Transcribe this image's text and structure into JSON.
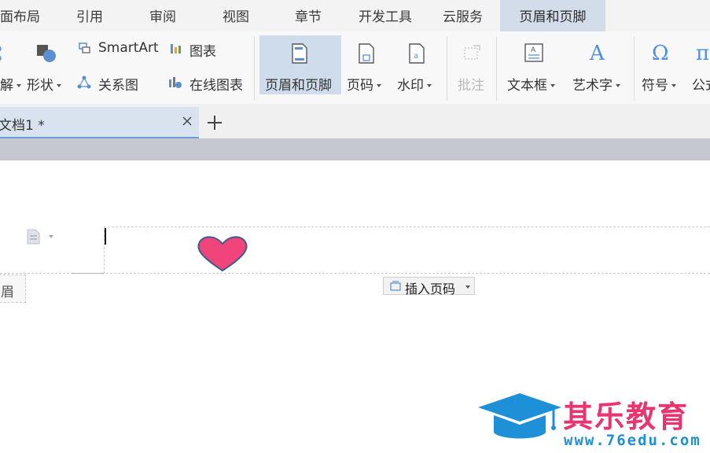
{
  "menu": {
    "tabs": [
      {
        "label": "面布局"
      },
      {
        "label": "引用"
      },
      {
        "label": "审阅"
      },
      {
        "label": "视图"
      },
      {
        "label": "章节"
      },
      {
        "label": "开发工具"
      },
      {
        "label": "云服务"
      },
      {
        "label": "页眉和页脚"
      }
    ],
    "active": "页眉和页脚"
  },
  "ribbon": {
    "partial_left": "解",
    "shapes": "形状",
    "smartart": "SmartArt",
    "chart": "图表",
    "relation": "关系图",
    "online_chart": "在线图表",
    "header_footer": "页眉和页脚",
    "page_number": "页码",
    "watermark": "水印",
    "comment": "批注",
    "textbox": "文本框",
    "wordart": "艺术字",
    "symbol": "符号",
    "formula": "公式"
  },
  "doc_tab": {
    "title": "文档1 *"
  },
  "page": {
    "header_label": "页眉",
    "insert_page_number": "插入页码"
  },
  "watermark_logo": {
    "name": "其乐教育",
    "url": "www.76edu.com"
  },
  "colors": {
    "active_tab": "#d3ddea",
    "heart": "#f0457a",
    "logo_blue": "#1e90d8",
    "logo_pink": "#e8356f"
  }
}
